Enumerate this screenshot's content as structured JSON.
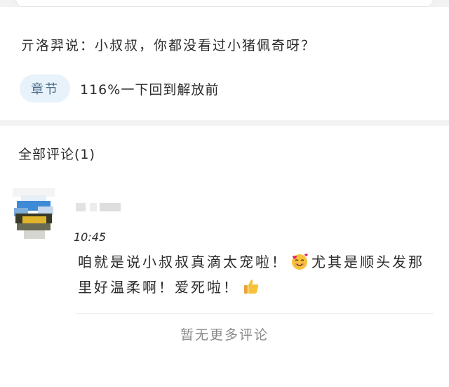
{
  "quote": {
    "text": "亓洛羿说：小叔叔，你都没看过小猪佩奇呀？"
  },
  "chapter": {
    "tag_label": "章节",
    "title": "116%一下回到解放前"
  },
  "comments": {
    "header": "全部评论(1)",
    "items": [
      {
        "time": "10:45",
        "text_part1": "咱就是说小叔叔真滴太宠啦！",
        "emoji1": "smiling-face-with-hearts",
        "text_part2": "尤其是顺头发那里好温柔啊！爱死啦！",
        "emoji2": "thumbs-up"
      }
    ],
    "no_more": "暂无更多评论"
  },
  "colors": {
    "chapter_tag_bg": "#e8f2fb",
    "chapter_tag_text": "#4d6e8c",
    "muted_text": "#8a8a8a"
  }
}
